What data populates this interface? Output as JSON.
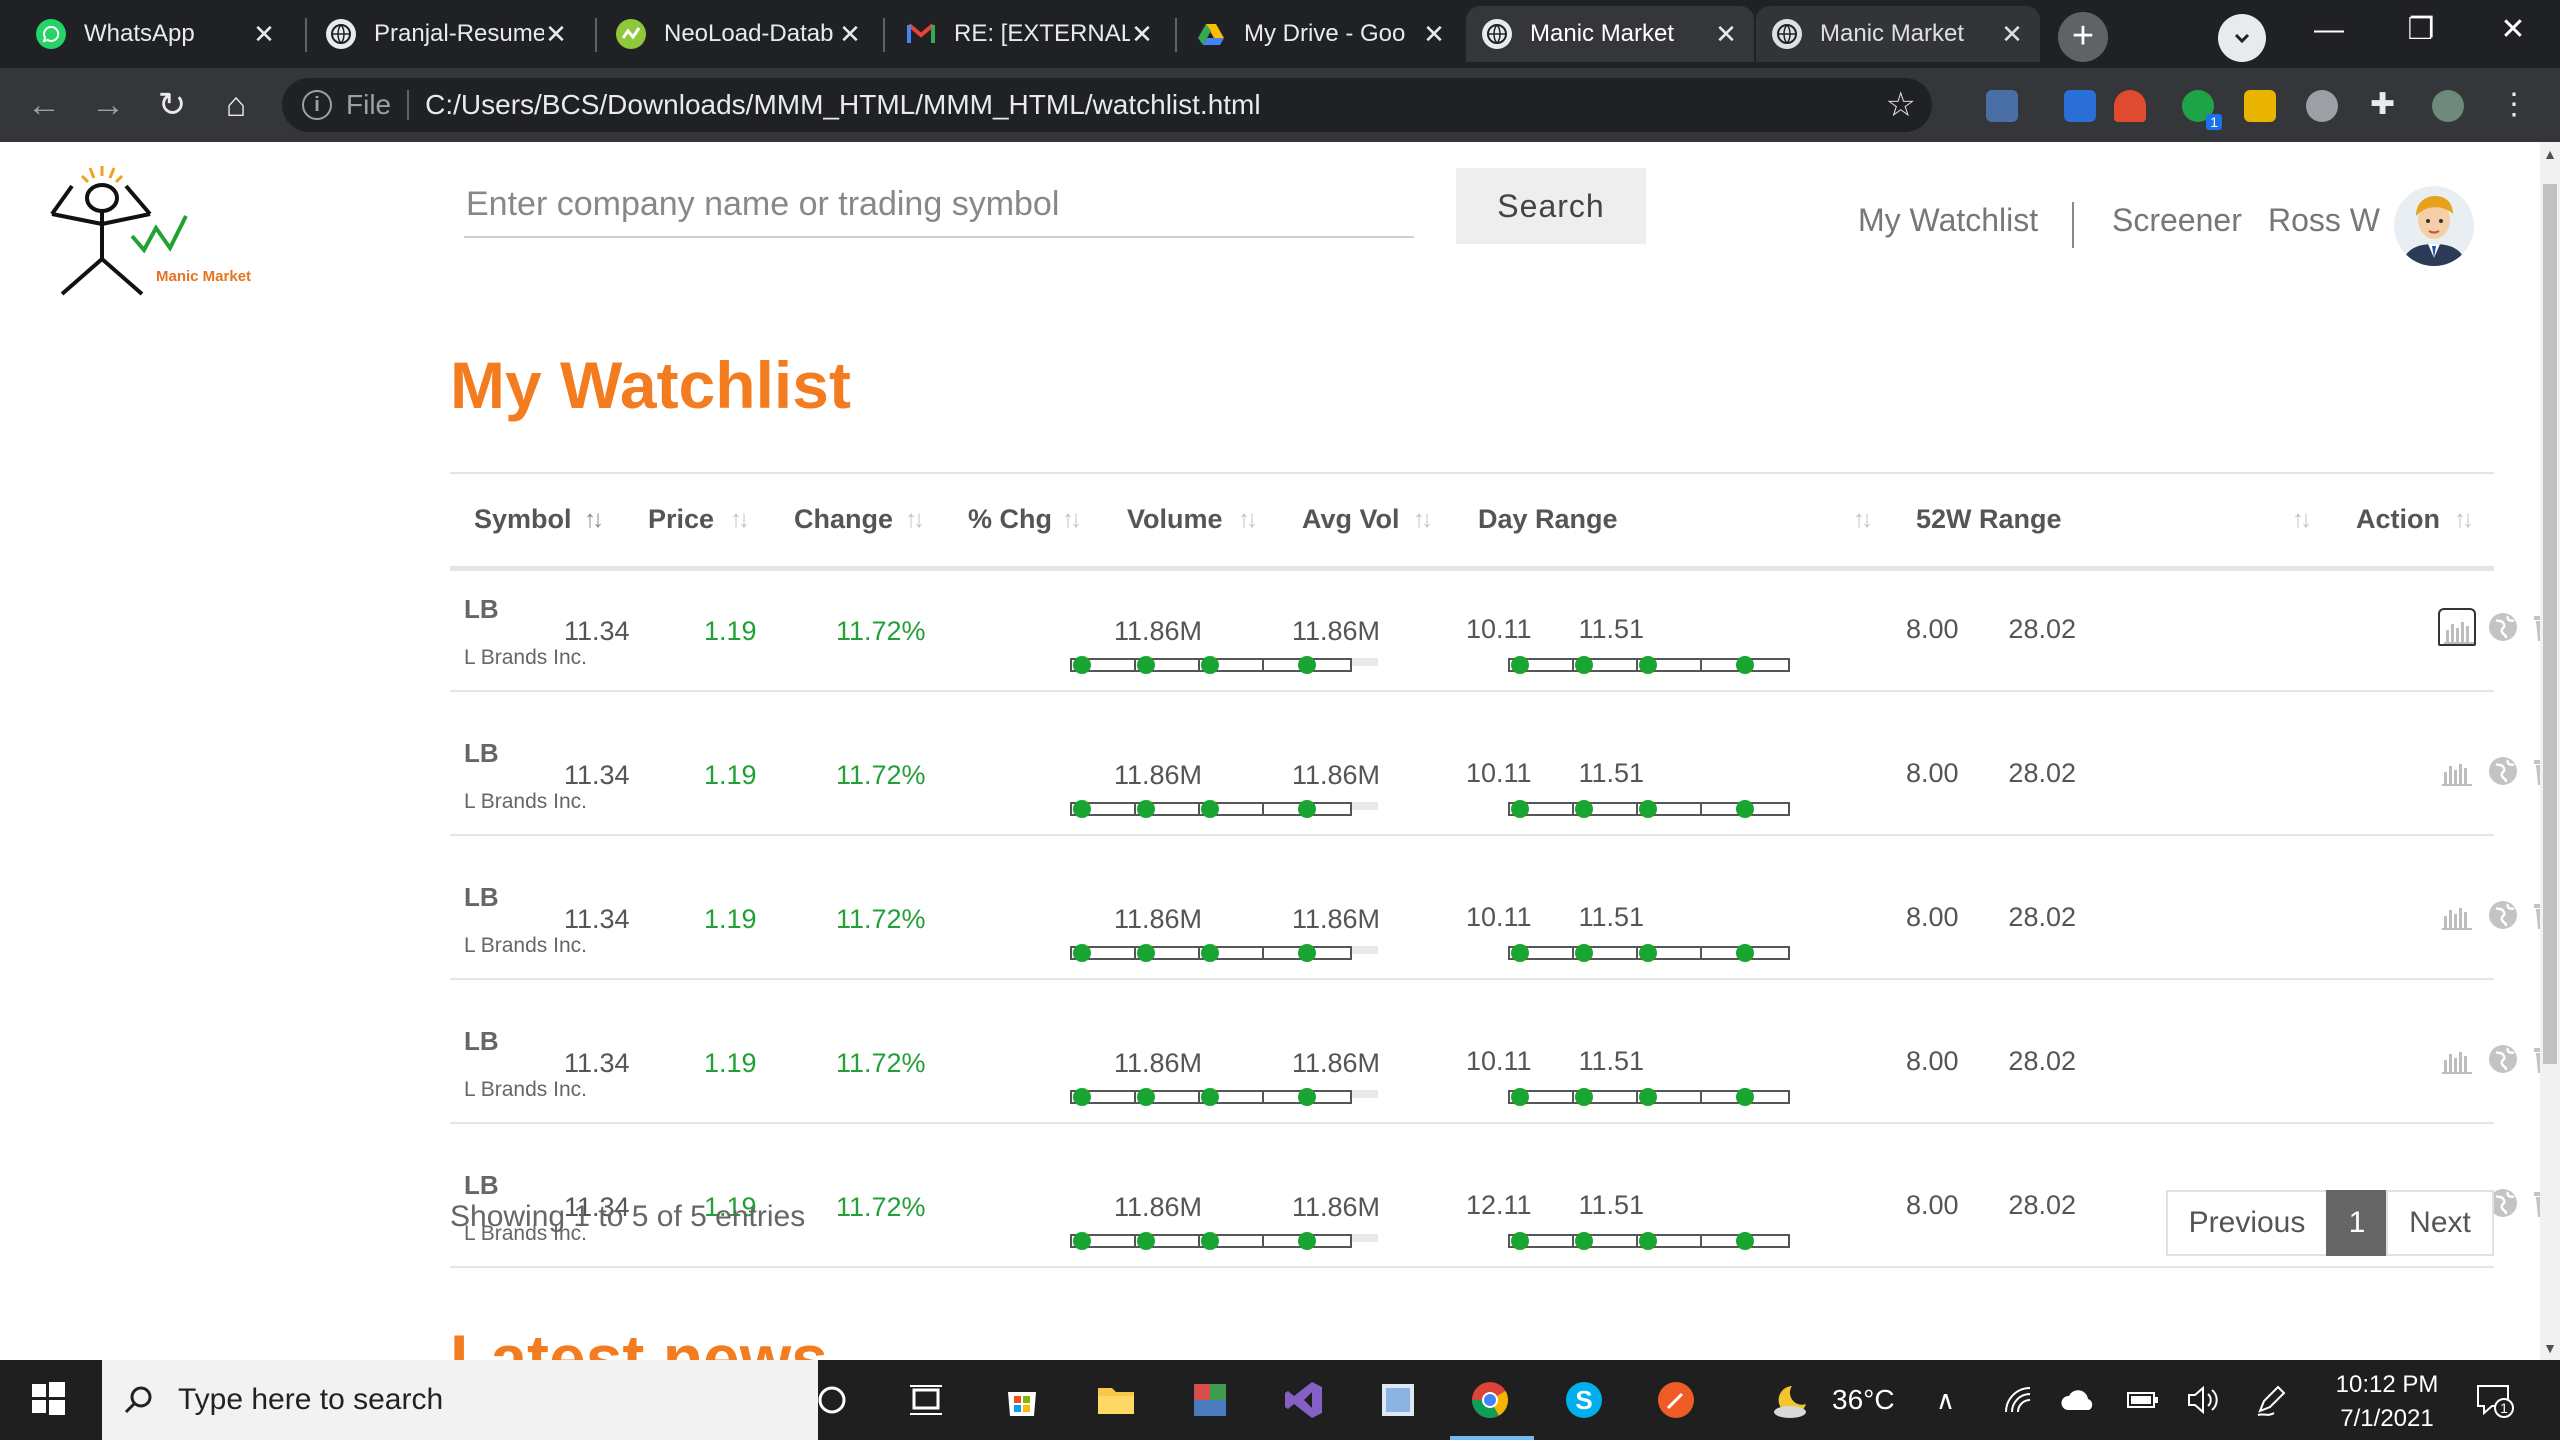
{
  "browser": {
    "tabs": [
      {
        "title": "WhatsApp",
        "icon": "whatsapp-icon"
      },
      {
        "title": "Pranjal-Resume",
        "icon": "globe-icon"
      },
      {
        "title": "NeoLoad-Datab",
        "icon": "neoload-icon"
      },
      {
        "title": "RE: [EXTERNAL]",
        "icon": "gmail-icon"
      },
      {
        "title": "My Drive - Goo",
        "icon": "drive-icon"
      },
      {
        "title": "Manic Market",
        "icon": "globe-icon",
        "active": true
      },
      {
        "title": "Manic Market",
        "icon": "globe-icon"
      }
    ],
    "address": {
      "scheme_label": "File",
      "url": "C:/Users/BCS/Downloads/MMM_HTML/MMM_HTML/watchlist.html"
    },
    "extension_badge": "1"
  },
  "site": {
    "logo_text": "Manic Market",
    "search": {
      "placeholder": "Enter company name or trading symbol",
      "value": "",
      "button": "Search"
    },
    "nav": {
      "watchlist": "My Watchlist",
      "screener": "Screener",
      "user": "Ross W"
    }
  },
  "watchlist": {
    "title": "My Watchlist",
    "columns": [
      "Symbol",
      "Price",
      "Change",
      "% Chg",
      "Volume",
      "Avg Vol",
      "Day Range",
      "52W Range",
      "Action"
    ],
    "rows": [
      {
        "symbol": "LB",
        "name": "L Brands Inc.",
        "price": "11.34",
        "change": "1.19",
        "pct": "11.72%",
        "volume": "11.86M",
        "avg_vol": "11.86M",
        "vol_fraction": 0.25,
        "day_low": "10.11",
        "day_high": "11.51",
        "w52_low": "8.00",
        "w52_high": "28.02"
      },
      {
        "symbol": "LB",
        "name": "L Brands Inc.",
        "price": "11.34",
        "change": "1.19",
        "pct": "11.72%",
        "volume": "11.86M",
        "avg_vol": "11.86M",
        "vol_fraction": 0.25,
        "day_low": "10.11",
        "day_high": "11.51",
        "w52_low": "8.00",
        "w52_high": "28.02"
      },
      {
        "symbol": "LB",
        "name": "L Brands Inc.",
        "price": "11.34",
        "change": "1.19",
        "pct": "11.72%",
        "volume": "11.86M",
        "avg_vol": "11.86M",
        "vol_fraction": 0.25,
        "day_low": "10.11",
        "day_high": "11.51",
        "w52_low": "8.00",
        "w52_high": "28.02"
      },
      {
        "symbol": "LB",
        "name": "L Brands Inc.",
        "price": "11.34",
        "change": "1.19",
        "pct": "11.72%",
        "volume": "11.86M",
        "avg_vol": "11.86M",
        "vol_fraction": 0.25,
        "day_low": "10.11",
        "day_high": "11.51",
        "w52_low": "8.00",
        "w52_high": "28.02"
      },
      {
        "symbol": "LB",
        "name": "L Brands Inc.",
        "price": "11.34",
        "change": "1.19",
        "pct": "11.72%",
        "volume": "11.86M",
        "avg_vol": "11.86M",
        "vol_fraction": 0.25,
        "day_low": "12.11",
        "day_high": "11.51",
        "w52_low": "8.00",
        "w52_high": "28.02"
      }
    ],
    "footer": {
      "info": "Showing 1 to 5 of 5 entries",
      "previous": "Previous",
      "page": "1",
      "next": "Next"
    }
  },
  "news": {
    "title": "Latest news"
  },
  "taskbar": {
    "search_placeholder": "Type here to search",
    "weather": "36°C",
    "time": "10:12 PM",
    "date": "7/1/2021",
    "notification_count": "1"
  },
  "colors": {
    "accent": "#f47c20",
    "positive": "#21a038",
    "chrome_dark": "#202124"
  }
}
